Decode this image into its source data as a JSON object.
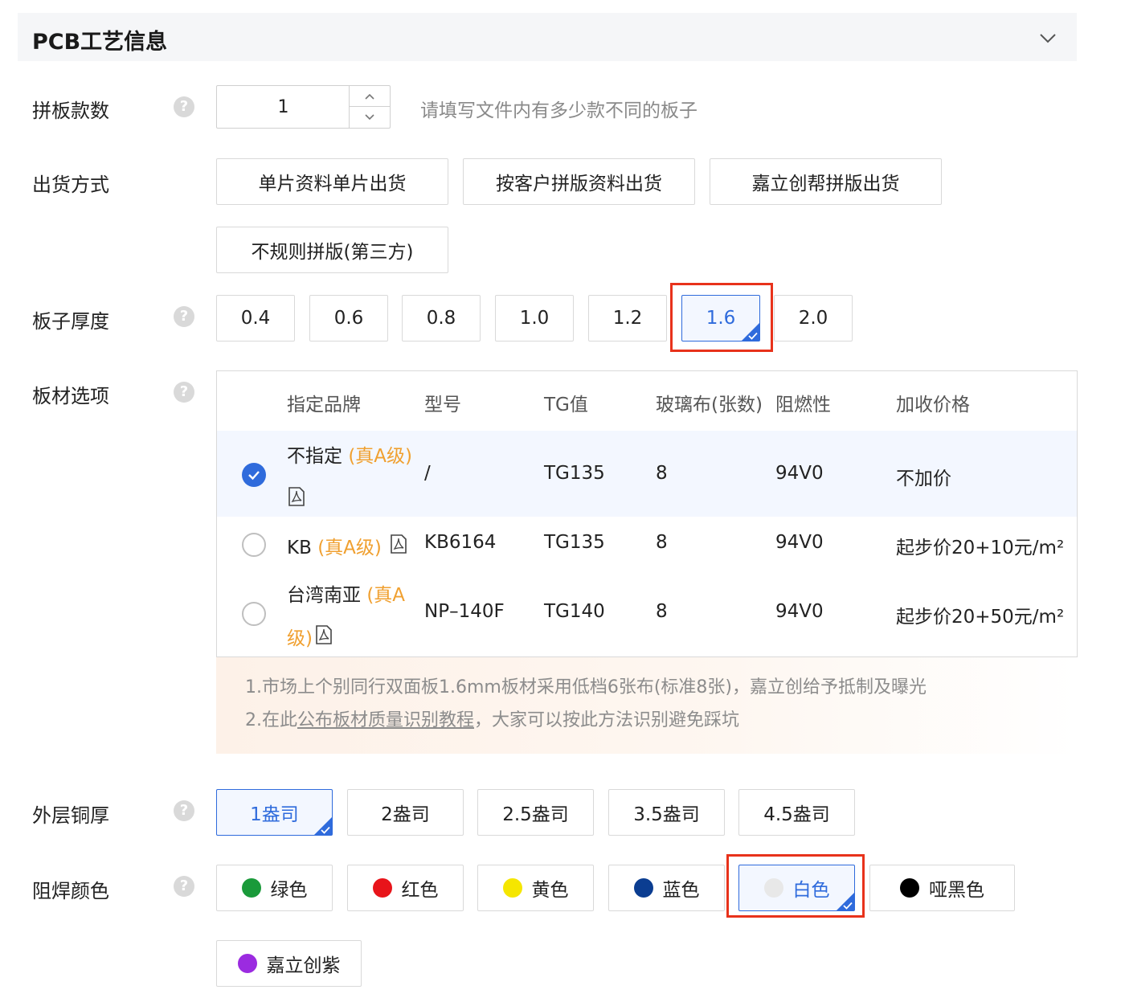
{
  "section": {
    "title": "PCB工艺信息"
  },
  "panel_count": {
    "label": "拼板款数",
    "value": "1",
    "hint": "请填写文件内有多少款不同的板子"
  },
  "shipping": {
    "label": "出货方式",
    "options": [
      "单片资料单片出货",
      "按客户拼版资料出货",
      "嘉立创帮拼版出货",
      "不规则拼版(第三方)"
    ]
  },
  "thickness": {
    "label": "板子厚度",
    "options": [
      "0.4",
      "0.6",
      "0.8",
      "1.0",
      "1.2",
      "1.6",
      "2.0"
    ],
    "selected": "1.6"
  },
  "material": {
    "label": "板材选项",
    "headers": [
      "指定品牌",
      "型号",
      "TG值",
      "玻璃布(张数)",
      "阻燃性",
      "加收价格"
    ],
    "rows": [
      {
        "brand": "不指定",
        "grade": "(真A级)",
        "model": "/",
        "tg": "TG135",
        "glass": "8",
        "flame": "94V0",
        "price": "不加价",
        "selected": true
      },
      {
        "brand": "KB",
        "grade": "(真A级)",
        "model": "KB6164",
        "tg": "TG135",
        "glass": "8",
        "flame": "94V0",
        "price": "起步价20+10元/m²",
        "selected": false
      },
      {
        "brand": "台湾南亚",
        "grade_part1": "(真A",
        "grade_part2": "级)",
        "model": "NP–140F",
        "tg": "TG140",
        "glass": "8",
        "flame": "94V0",
        "price": "起步价20+50元/m²",
        "selected": false
      }
    ],
    "notice": {
      "line1": "1.市场上个别同行双面板1.6mm板材采用低档6张布(标准8张)，嘉立创给予抵制及曝光",
      "line2_prefix": "2.在此",
      "line2_link": "公布板材质量识别教程",
      "line2_suffix": "，大家可以按此方法识别避免踩坑"
    }
  },
  "copper": {
    "label": "外层铜厚",
    "options": [
      "1盎司",
      "2盎司",
      "2.5盎司",
      "3.5盎司",
      "4.5盎司"
    ],
    "selected": "1盎司"
  },
  "solder_mask": {
    "label": "阻焊颜色",
    "options": [
      {
        "label": "绿色",
        "color": "#1a9a3a"
      },
      {
        "label": "红色",
        "color": "#e8141a"
      },
      {
        "label": "黄色",
        "color": "#f5e600"
      },
      {
        "label": "蓝色",
        "color": "#0b3d91"
      },
      {
        "label": "白色",
        "color": "#e8e8e8"
      },
      {
        "label": "哑黑色",
        "color": "#000000"
      },
      {
        "label": "嘉立创紫",
        "color": "#9b2be0"
      }
    ],
    "selected": "白色"
  },
  "icons": {
    "help": "?",
    "collapse": "chevron-down-icon",
    "pdf": "pdf-icon"
  },
  "accent_color": "#2f6bdc",
  "highlight_color": "#e8321b"
}
